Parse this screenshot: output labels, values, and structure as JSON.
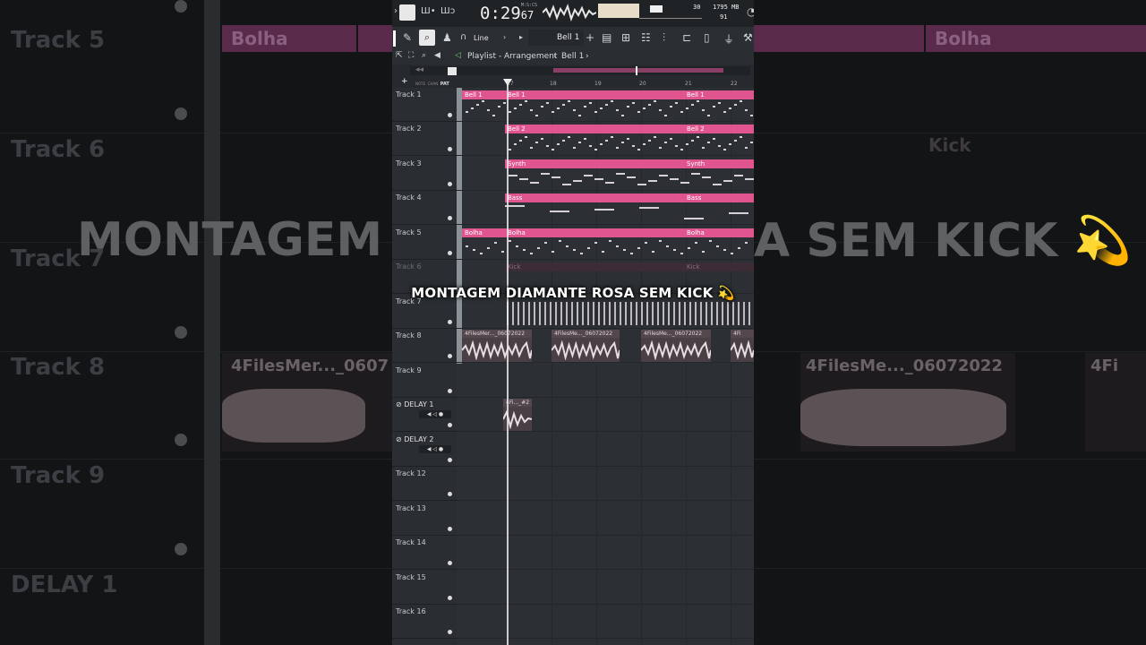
{
  "transport": {
    "time": "0:29",
    "time_sub": "67",
    "time_label": "M:S:CS",
    "cpu_value": "30",
    "memory": "1795 MB",
    "polyphony": "91"
  },
  "toolbar": {
    "snap_mode": "Line",
    "pattern_name": "Bell 1"
  },
  "breadcrumb": {
    "window": "Playlist - Arrangement",
    "pattern": "Bell 1"
  },
  "ruler": {
    "labels": [
      "17",
      "18",
      "19",
      "20",
      "21",
      "22"
    ]
  },
  "tracks": [
    {
      "name": "Track 1"
    },
    {
      "name": "Track 2"
    },
    {
      "name": "Track 3"
    },
    {
      "name": "Track 4"
    },
    {
      "name": "Track 5"
    },
    {
      "name": "Track 6"
    },
    {
      "name": "Track 7"
    },
    {
      "name": "Track 8"
    },
    {
      "name": "Track 9"
    },
    {
      "name": "DELAY 1"
    },
    {
      "name": "DELAY 2"
    },
    {
      "name": "Track 12"
    },
    {
      "name": "Track 13"
    },
    {
      "name": "Track 14"
    },
    {
      "name": "Track 15"
    },
    {
      "name": "Track 16"
    }
  ],
  "clips": {
    "bell1": "Bell 1",
    "bell2": "Bell 2",
    "synth": "Synth",
    "bass": "Bass",
    "bolha": "Bolha",
    "kick": "Kick",
    "audio_a": "4FilesMer..._06072022",
    "audio_b": "4FilesMe..._06072022",
    "audio_c": "4FilesMe..._06072022",
    "audio_d": "4Fi",
    "delay_clip": "4Fi..._#2"
  },
  "caption": "MONTAGEM DIAMANTE ROSA SEM KICK 💫",
  "background": {
    "left_tracks": [
      "Track 5",
      "Track 6",
      "Track 7",
      "Track 8",
      "Track 9",
      "DELAY 1"
    ],
    "right_clip_bolha": "Bolha",
    "right_clip_kick": "Kick",
    "left_clip_bolha": "Bolha",
    "right_audio": "4FilesMe..._06072022",
    "left_audio": "4FilesMer..._0607",
    "right_audio2": "4Fi",
    "big_left": "MONTAGEM D",
    "big_right": "A SEM KICK 💫"
  },
  "colors": {
    "clip_pink": "#e0558f",
    "playhead": "#e8e8e8"
  }
}
